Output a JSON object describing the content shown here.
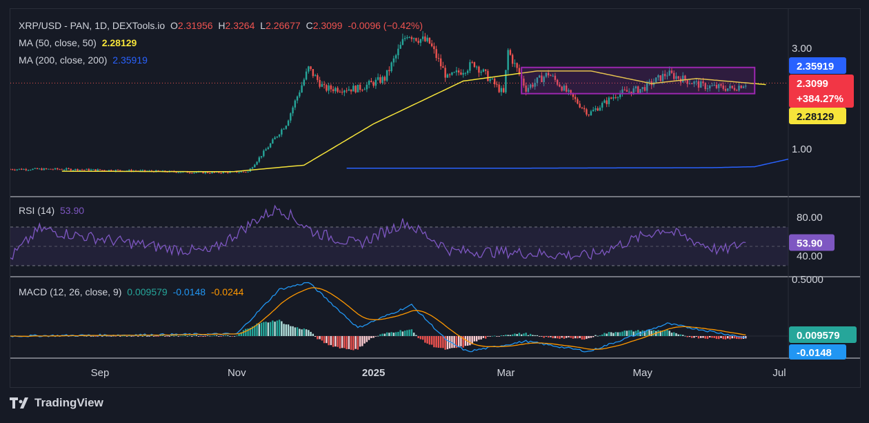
{
  "header": {
    "symbol": "XRP/USD - PAN, 1D, DEXTools.io",
    "o_label": "O",
    "o_val": "2.31956",
    "h_label": "H",
    "h_val": "2.3264",
    "l_label": "L",
    "l_val": "2.26677",
    "c_label": "C",
    "c_val": "2.3099",
    "change": "-0.0096 (−0.42%)"
  },
  "ma50": {
    "label": "MA (50, close, 50)",
    "value": "2.28129",
    "color": "#f6e43a"
  },
  "ma200": {
    "label": "MA (200, close, 200)",
    "value": "2.35919",
    "color": "#2962ff"
  },
  "rsi": {
    "label": "RSI (14)",
    "value": "53.90",
    "color": "#7e57c2"
  },
  "macd": {
    "label": "MACD (12, 26, close, 9)",
    "hist": "0.009579",
    "macd": "-0.0148",
    "signal": "-0.0244"
  },
  "price_axis": {
    "ticks": [
      "3.00",
      "1.00"
    ],
    "badge_ma200": "2.35919",
    "badge_close": "2.3099",
    "badge_pct": "+384.27%",
    "badge_ma50": "2.28129"
  },
  "rsi_axis": {
    "ticks": [
      "80.00",
      "40.00"
    ],
    "badge": "53.90"
  },
  "macd_axis": {
    "ticks": [
      "0.5000"
    ],
    "badge_hist": "0.009579",
    "badge_macd": "-0.0148"
  },
  "time_axis": [
    "Sep",
    "Nov",
    "2025",
    "Mar",
    "May",
    "Jul"
  ],
  "brand": "TradingView",
  "colors": {
    "up": "#26a69a",
    "down": "#ef5350",
    "ma50": "#f6e43a",
    "ma200": "#2962ff",
    "rsi": "#7e57c2",
    "macd": "#2196f3",
    "signal": "#ff9800",
    "box": "#9c27b0"
  },
  "chart_data": {
    "type": "candlestick",
    "x_range": [
      "2024-07-23",
      "2025-07-05"
    ],
    "price_key": [
      {
        "x": "2024-07-23",
        "y": 0.6
      },
      {
        "x": "2024-08-15",
        "y": 0.6
      },
      {
        "x": "2024-09-15",
        "y": 0.57
      },
      {
        "x": "2024-10-20",
        "y": 0.53
      },
      {
        "x": "2024-11-06",
        "y": 0.55
      },
      {
        "x": "2024-11-16",
        "y": 1.1
      },
      {
        "x": "2024-11-23",
        "y": 1.5
      },
      {
        "x": "2024-12-03",
        "y": 2.6
      },
      {
        "x": "2024-12-10",
        "y": 2.2
      },
      {
        "x": "2024-12-25",
        "y": 2.2
      },
      {
        "x": "2025-01-06",
        "y": 2.4
      },
      {
        "x": "2025-01-16",
        "y": 3.3
      },
      {
        "x": "2025-01-26",
        "y": 3.1
      },
      {
        "x": "2025-02-03",
        "y": 2.4
      },
      {
        "x": "2025-02-15",
        "y": 2.7
      },
      {
        "x": "2025-02-28",
        "y": 2.1
      },
      {
        "x": "2025-03-02",
        "y": 2.95
      },
      {
        "x": "2025-03-10",
        "y": 2.2
      },
      {
        "x": "2025-03-20",
        "y": 2.5
      },
      {
        "x": "2025-04-07",
        "y": 1.7
      },
      {
        "x": "2025-04-20",
        "y": 2.1
      },
      {
        "x": "2025-05-01",
        "y": 2.2
      },
      {
        "x": "2025-05-12",
        "y": 2.5
      },
      {
        "x": "2025-05-28",
        "y": 2.25
      },
      {
        "x": "2025-06-10",
        "y": 2.2
      },
      {
        "x": "2025-06-16",
        "y": 2.31
      }
    ],
    "ma50_key": [
      {
        "x": "2024-08-15",
        "y": 0.56
      },
      {
        "x": "2024-10-30",
        "y": 0.55
      },
      {
        "x": "2024-12-01",
        "y": 0.68
      },
      {
        "x": "2025-01-01",
        "y": 1.5
      },
      {
        "x": "2025-02-10",
        "y": 2.35
      },
      {
        "x": "2025-03-15",
        "y": 2.55
      },
      {
        "x": "2025-04-08",
        "y": 2.55
      },
      {
        "x": "2025-05-05",
        "y": 2.3
      },
      {
        "x": "2025-05-25",
        "y": 2.4
      },
      {
        "x": "2025-06-25",
        "y": 2.28
      }
    ],
    "ma200_key": [
      {
        "x": "2024-12-20",
        "y": 0.62
      },
      {
        "x": "2025-03-01",
        "y": 0.62
      },
      {
        "x": "2025-06-01",
        "y": 0.63
      },
      {
        "x": "2025-06-20",
        "y": 0.65
      },
      {
        "x": "2025-07-05",
        "y": 0.8
      }
    ],
    "rsi_key": [
      {
        "x": "2024-07-23",
        "y": 38
      },
      {
        "x": "2024-08-05",
        "y": 68
      },
      {
        "x": "2024-08-20",
        "y": 62
      },
      {
        "x": "2024-09-10",
        "y": 55
      },
      {
        "x": "2024-10-01",
        "y": 48
      },
      {
        "x": "2024-10-20",
        "y": 44
      },
      {
        "x": "2024-11-10",
        "y": 78
      },
      {
        "x": "2024-11-20",
        "y": 90
      },
      {
        "x": "2024-12-05",
        "y": 65
      },
      {
        "x": "2024-12-25",
        "y": 52
      },
      {
        "x": "2025-01-15",
        "y": 75
      },
      {
        "x": "2025-02-05",
        "y": 45
      },
      {
        "x": "2025-03-01",
        "y": 44
      },
      {
        "x": "2025-04-07",
        "y": 40
      },
      {
        "x": "2025-05-10",
        "y": 68
      },
      {
        "x": "2025-06-05",
        "y": 45
      },
      {
        "x": "2025-06-16",
        "y": 53.9
      }
    ],
    "rsi_band": [
      30,
      70
    ],
    "macd_key": [
      {
        "x": "2024-07-23",
        "y": 0.0
      },
      {
        "x": "2024-11-01",
        "y": 0.02
      },
      {
        "x": "2024-11-20",
        "y": 0.45
      },
      {
        "x": "2024-12-03",
        "y": 0.52
      },
      {
        "x": "2024-12-25",
        "y": 0.08
      },
      {
        "x": "2025-01-18",
        "y": 0.3
      },
      {
        "x": "2025-02-03",
        "y": -0.05
      },
      {
        "x": "2025-02-12",
        "y": -0.15
      },
      {
        "x": "2025-03-10",
        "y": -0.05
      },
      {
        "x": "2025-04-07",
        "y": -0.15
      },
      {
        "x": "2025-05-12",
        "y": 0.12
      },
      {
        "x": "2025-06-16",
        "y": -0.0148
      }
    ]
  }
}
